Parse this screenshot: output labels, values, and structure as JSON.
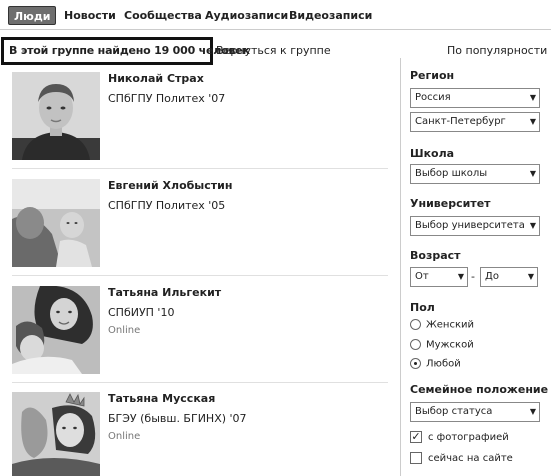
{
  "tabs": [
    {
      "label": "Люди",
      "active": true
    },
    {
      "label": "Новости",
      "active": false
    },
    {
      "label": "Сообщества",
      "active": false
    },
    {
      "label": "Аудиозаписи",
      "active": false
    },
    {
      "label": "Видеозаписи",
      "active": false
    }
  ],
  "search": {
    "found_text": "В этой группе найдено 19 000 человек",
    "back_link": "Вернуться к группе",
    "sort_label": "По популярности"
  },
  "people": [
    {
      "name": "Николай Страх",
      "school": "СПбГПУ Политех '07",
      "online": ""
    },
    {
      "name": "Евгений Хлобыстин",
      "school": "СПбГПУ Политех '05",
      "online": ""
    },
    {
      "name": "Татьяна Ильгекит",
      "school": "СПбИУП '10",
      "online": "Online"
    },
    {
      "name": "Татьяна Мусская",
      "school": "БГЭУ (бывш. БГИНХ) '07",
      "online": "Online"
    }
  ],
  "filters": {
    "region_label": "Регион",
    "country": "Россия",
    "city": "Санкт-Петербург",
    "school_label": "Школа",
    "school_select": "Выбор школы",
    "university_label": "Университет",
    "university_select": "Выбор университета",
    "age_label": "Возраст",
    "age_from": "От",
    "age_dash": "-",
    "age_to": "До",
    "gender_label": "Пол",
    "gender_options": [
      "Женский",
      "Мужской",
      "Любой"
    ],
    "gender_selected": "Любой",
    "marital_label": "Семейное положение",
    "marital_select": "Выбор статуса",
    "with_photo": "с фотографией",
    "with_photo_checked": true,
    "online_now": "сейчас на сайте",
    "online_now_checked": false
  }
}
